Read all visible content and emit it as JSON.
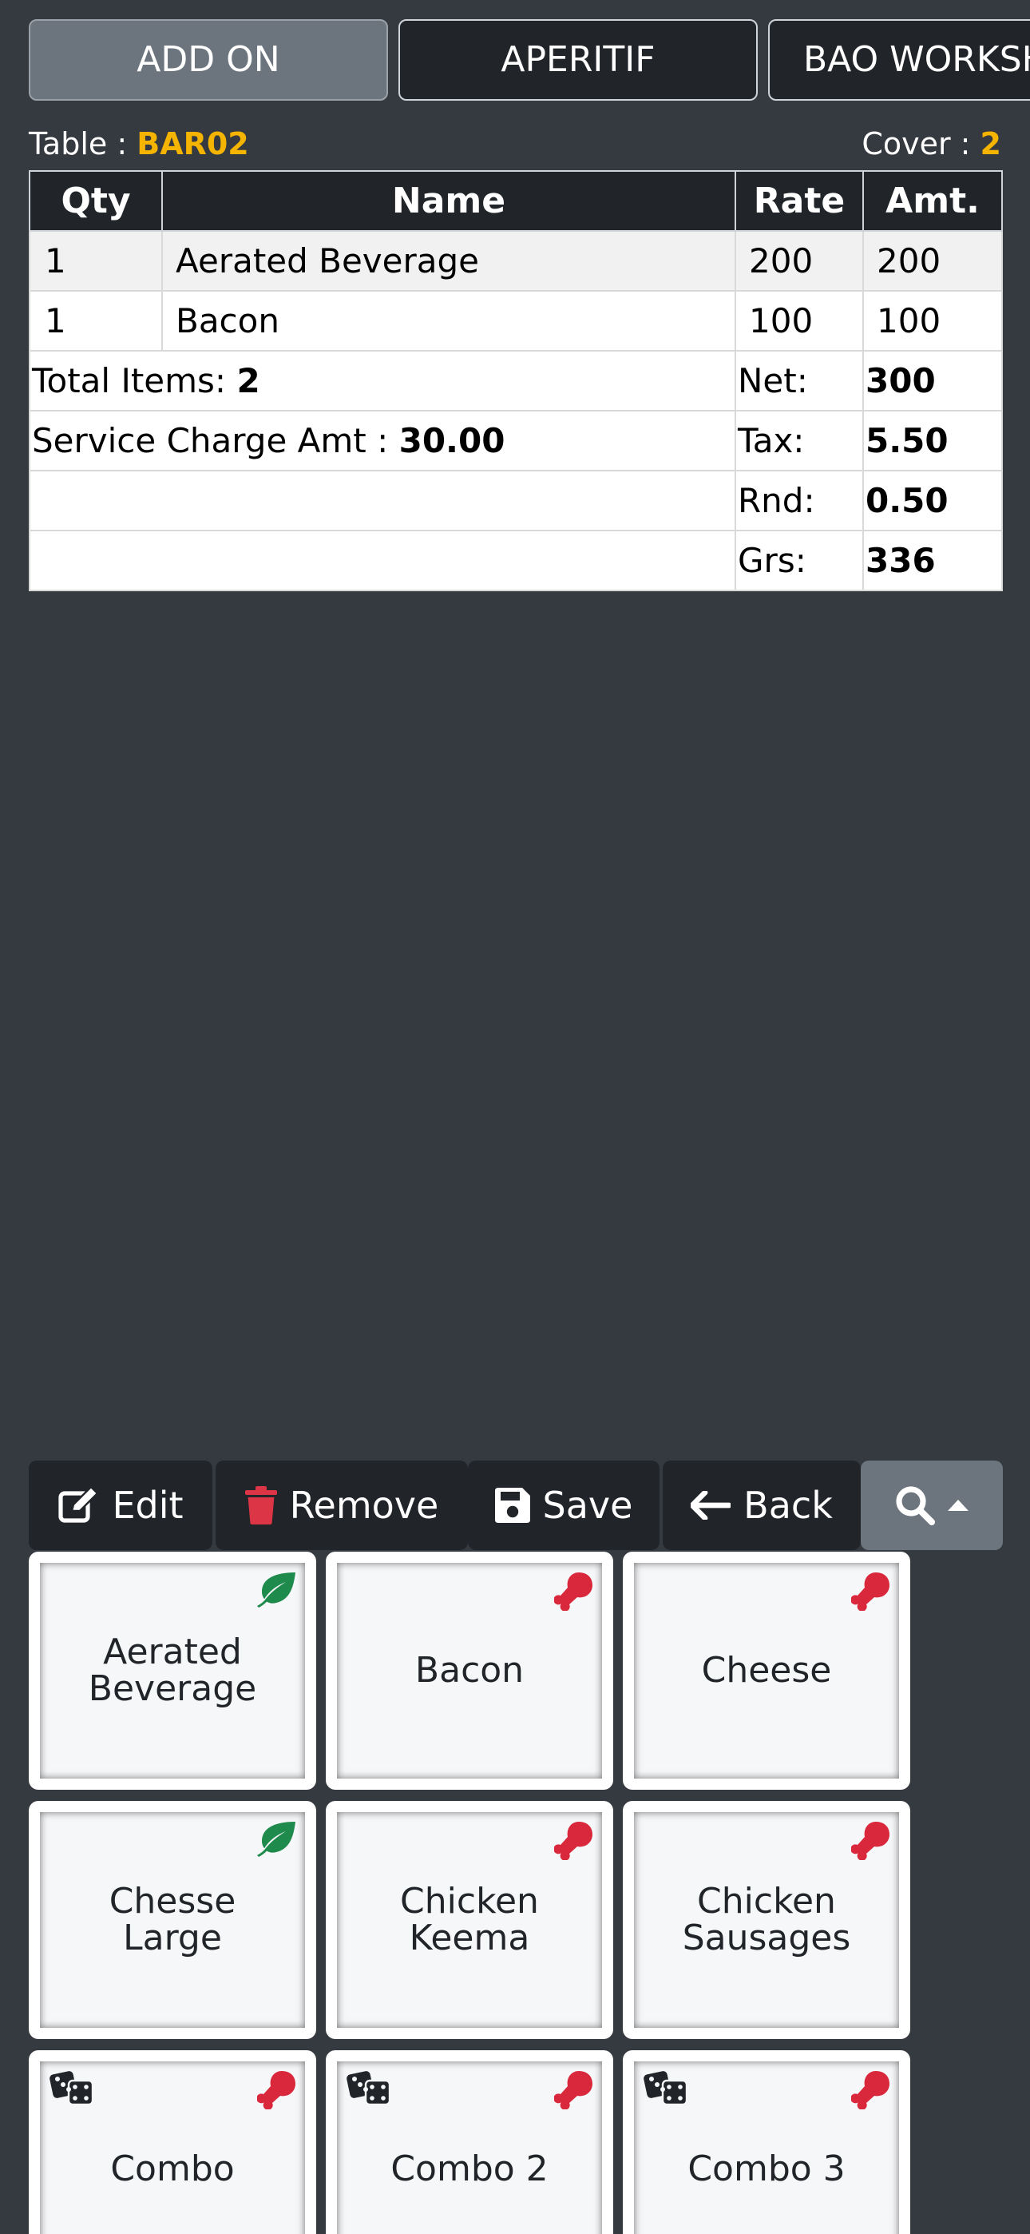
{
  "tabs": [
    {
      "label": "ADD ON",
      "active": true
    },
    {
      "label": "APERITIF",
      "active": false
    },
    {
      "label": "BAO WORKSHOP",
      "active": false
    }
  ],
  "order_info": {
    "table_label": "Table : ",
    "table_value": "BAR02",
    "cover_label": "Cover : ",
    "cover_value": "2"
  },
  "order_table": {
    "headers": {
      "qty": "Qty",
      "name": "Name",
      "rate": "Rate",
      "amt": "Amt."
    },
    "rows": [
      {
        "qty": "1",
        "name": "Aerated Beverage",
        "rate": "200",
        "amt": "200"
      },
      {
        "qty": "1",
        "name": "Bacon",
        "rate": "100",
        "amt": "100"
      }
    ]
  },
  "summary": {
    "total_items_label": "Total Items: ",
    "total_items_value": "2",
    "service_charge_label": "Service Charge Amt : ",
    "service_charge_value": "30.00",
    "net_label": "Net:",
    "net_value": "300",
    "tax_label": "Tax:",
    "tax_value": "5.50",
    "rnd_label": "Rnd:",
    "rnd_value": "0.50",
    "grs_label": "Grs:",
    "grs_value": "336"
  },
  "toolbar": {
    "edit_label": "Edit",
    "remove_label": "Remove",
    "save_label": "Save",
    "back_label": "Back",
    "edit_icon": "edit-icon",
    "remove_icon": "trash-icon",
    "save_icon": "floppy-disk-icon",
    "back_icon": "arrow-left-icon",
    "search_icon": "search-icon",
    "search_caret_icon": "caret-up-icon"
  },
  "items": [
    {
      "name": "Aerated Beverage",
      "type": "veg",
      "combo": false
    },
    {
      "name": "Bacon",
      "type": "non-veg",
      "combo": false
    },
    {
      "name": "Cheese",
      "type": "non-veg",
      "combo": false
    },
    {
      "name": "Chesse Large",
      "type": "veg",
      "combo": false
    },
    {
      "name": "Chicken Keema",
      "type": "non-veg",
      "combo": false
    },
    {
      "name": "Chicken Sausages",
      "type": "non-veg",
      "combo": false
    },
    {
      "name": "Combo",
      "type": "non-veg",
      "combo": true
    },
    {
      "name": "Combo 2",
      "type": "non-veg",
      "combo": true
    },
    {
      "name": "Combo 3",
      "type": "non-veg",
      "combo": true
    }
  ],
  "colors": {
    "background": "#353940",
    "dark": "#212429",
    "active_tab": "#6c757d",
    "highlight": "#f4b400",
    "veg": "#1e8a4c",
    "non_veg": "#d9283c",
    "trash": "#dc3545"
  }
}
